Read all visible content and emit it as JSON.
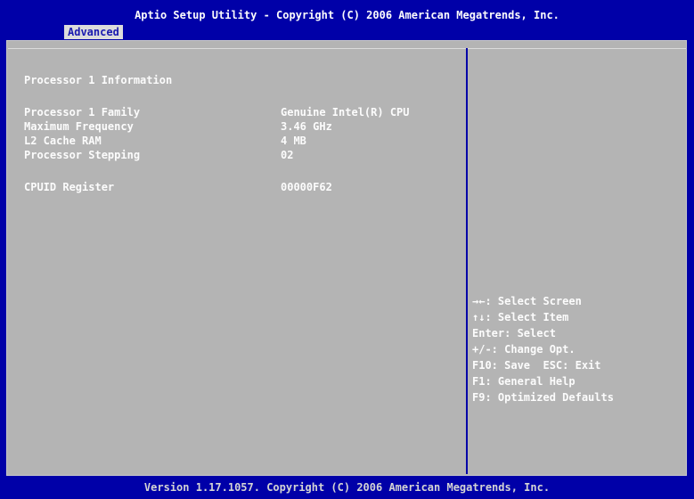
{
  "header": {
    "title": "Aptio Setup Utility - Copyright (C) 2006 American Megatrends, Inc.",
    "active_tab": "Advanced"
  },
  "main": {
    "section_title": "Processor 1 Information",
    "rows": [
      {
        "label": "Processor 1 Family",
        "value": "Genuine Intel(R) CPU"
      },
      {
        "label": "Maximum Frequency",
        "value": "3.46 GHz"
      },
      {
        "label": "L2 Cache RAM",
        "value": "4 MB"
      },
      {
        "label": "Processor Stepping",
        "value": "02"
      },
      {
        "label": "CPUID Register",
        "value": "00000F62"
      }
    ]
  },
  "help": {
    "lines": [
      "→←: Select Screen",
      "↑↓: Select Item",
      "Enter: Select",
      "+/-: Change Opt.",
      "F10: Save  ESC: Exit",
      "F1: General Help",
      "F9: Optimized Defaults"
    ]
  },
  "footer": {
    "version": "Version 1.17.1057. Copyright (C) 2006 American Megatrends, Inc."
  },
  "colors": {
    "background": "#0000a8",
    "panel": "#b4b4b4",
    "text": "#fcfcfc",
    "tab_bg": "#dcdcdc",
    "tab_text": "#1a1ab0"
  }
}
